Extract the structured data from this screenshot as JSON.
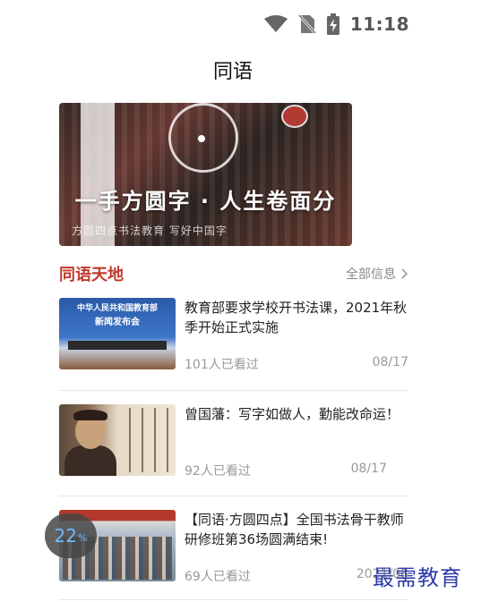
{
  "status_bar": {
    "time": "11:18",
    "icons": [
      "wifi-icon",
      "no-sim-icon",
      "battery-charging-icon"
    ]
  },
  "header": {
    "title": "同语"
  },
  "banner": {
    "headline": "一手方圆字 · 人生卷面分",
    "subline": "方圆四点书法教育 写好中国字"
  },
  "section": {
    "title": "同语天地",
    "more_label": "全部信息",
    "more_icon": "chevron-right-icon"
  },
  "news": [
    {
      "title": "教育部要求学校开书法课，2021年秋季开始正式实施",
      "views": "101人已看过",
      "date": "08/17",
      "thumb_text_1": "中华人民共和国教育部",
      "thumb_text_2": "新闻发布会"
    },
    {
      "title": "曾国藩：写字如做人，勤能改命运！",
      "views": "92人已看过",
      "date": "08/17"
    },
    {
      "title": "【同语·方圆四点】全国书法骨干教师研修班第36场圆满结束!",
      "views": "69人已看过",
      "date": "2021/08"
    }
  ],
  "overlay": {
    "progress_value": "22",
    "progress_unit": "%"
  },
  "watermark": {
    "text": "最需教育"
  },
  "colors": {
    "accent": "#c0392b",
    "progress_text": "#6fb8ff",
    "watermark": "#2d3aa8"
  }
}
